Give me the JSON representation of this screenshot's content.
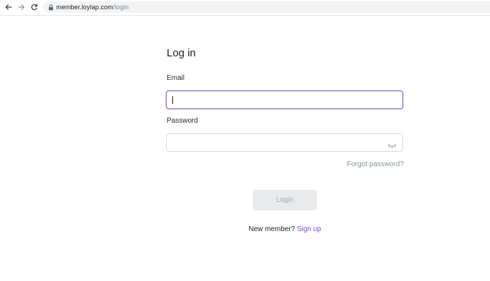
{
  "browser": {
    "url_host": "member.loylap.com",
    "url_path": "/login",
    "back_icon": "arrow-left-icon",
    "forward_icon": "arrow-right-icon",
    "reload_icon": "reload-icon",
    "lock_icon": "lock-icon"
  },
  "login": {
    "title": "Log in",
    "email_label": "Email",
    "email_value": "",
    "password_label": "Password",
    "password_value": "",
    "password_toggle_icon": "eye-closed-icon",
    "forgot_password": "Forgot password?",
    "login_button": "Login",
    "signup_prompt": "New member?",
    "signup_link": "Sign up"
  },
  "colors": {
    "accent": "#7b4bd0",
    "focus_border": "#8d62d6",
    "muted_link": "#8a93a6",
    "disabled_button_bg": "#e8eaec",
    "disabled_button_text": "#a2a7ad"
  }
}
